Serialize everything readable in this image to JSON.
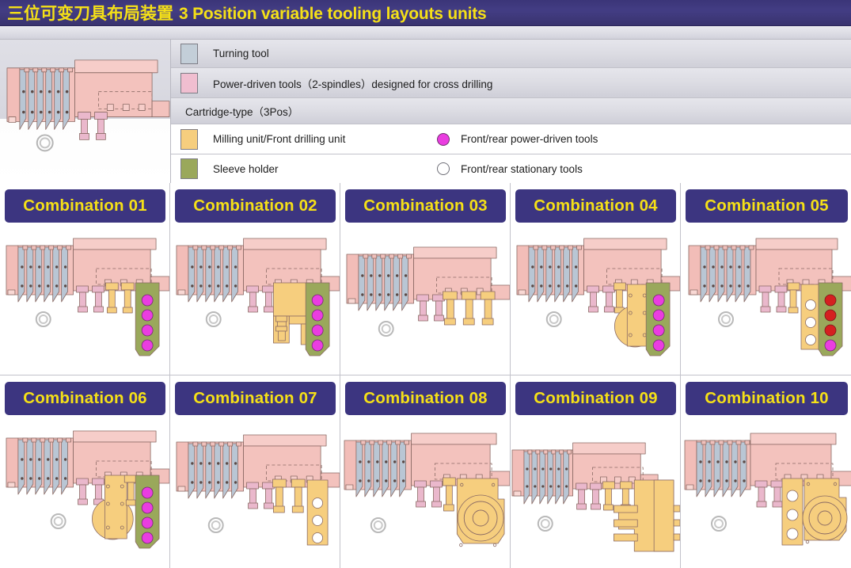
{
  "header": {
    "title_cn": "三位可变刀具布局装置",
    "title_en": "3 Position variable tooling layouts units"
  },
  "legend": {
    "rows": [
      {
        "swatch": "turning-tool-swatch",
        "color": "#c3ced8",
        "label": "Turning  tool"
      },
      {
        "swatch": "power-driven-tools-swatch",
        "color": "#f0bed0",
        "label": "Power-driven tools（2-spindles）designed for cross drilling"
      }
    ],
    "section_label": "Cartridge-type（3Pos）",
    "cartridge_rows": [
      {
        "swatch": "milling-unit-swatch",
        "color": "#f6ce7e",
        "label": "Milling unit/Front drilling unit",
        "marker": "front-rear-power-driven-dot",
        "marker_color": "#ea3de0",
        "marker_label": "Front/rear power-driven tools"
      },
      {
        "swatch": "sleeve-holder-swatch",
        "color": "#9aa85b",
        "label": "Sleeve holder",
        "marker": "front-rear-stationary-dot",
        "marker_color": "#ffffff",
        "marker_label": "Front/rear stationary tools"
      }
    ]
  },
  "combinations": [
    {
      "label": "Combination 01",
      "variant": "c01"
    },
    {
      "label": "Combination 02",
      "variant": "c02"
    },
    {
      "label": "Combination  03",
      "variant": "c03"
    },
    {
      "label": "Combination  04",
      "variant": "c04"
    },
    {
      "label": "Combination  05",
      "variant": "c05"
    },
    {
      "label": "Combination 06",
      "variant": "c06"
    },
    {
      "label": "Combination 07",
      "variant": "c07"
    },
    {
      "label": "Combination  08",
      "variant": "c08"
    },
    {
      "label": "Combination  09",
      "variant": "c09"
    },
    {
      "label": "Combination  10",
      "variant": "c10"
    }
  ],
  "colors": {
    "title_bar": "#3b3578",
    "title_text": "#f5e017",
    "badge_bg": "#3c3580",
    "badge_text": "#f5e017",
    "body_pink": "#f5c4c0",
    "body_pink_light": "#f8d3cf",
    "turning_blade": "#b9c6d4",
    "power_tool_pink": "#eab8cc",
    "milling_orange": "#f6ce7e",
    "sleeve_green": "#9aa85b",
    "dot_magenta": "#ea3de0",
    "dot_red": "#d52020",
    "dot_white": "#ffffff",
    "outline": "#6b5550"
  }
}
